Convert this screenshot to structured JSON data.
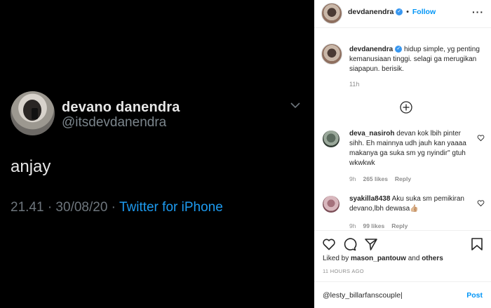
{
  "tweet": {
    "display_name": "devano danendra",
    "handle": "@itsdevdanendra",
    "text": "anjay",
    "datetime": "21.41 · 30/08/20 · ",
    "source": "Twitter for iPhone"
  },
  "instagram": {
    "header": {
      "username": "devdanendra",
      "follow_label": "Follow",
      "more_label": "···"
    },
    "caption": {
      "username": "devdanendra",
      "text": " hidup simple, yg penting kemanusiaan tinggi. selagi ga merugikan siapapun. berisik.",
      "time": "11h"
    },
    "comments": [
      {
        "username": "deva_nasiroh",
        "text": " devan kok lbih pinter sihh. Eh mainnya udh jauh kan yaaaa makanya ga suka sm yg nyindir\" gtuh wkwkwk",
        "time": "9h",
        "likes": "265 likes",
        "reply": "Reply"
      },
      {
        "username": "syakilla8438",
        "text": " Aku suka sm pemikiran devano,lbh dewasa👍🏼",
        "time": "9h",
        "likes": "99 likes",
        "reply": "Reply"
      }
    ],
    "liked_by_prefix": "Liked by ",
    "liked_by_user": "mason_pantouw",
    "liked_by_and": " and ",
    "liked_by_others": "others",
    "post_time": "11 HOURS AGO",
    "comment_input_value": "@lesty_billarfanscouple|",
    "post_label": "Post"
  },
  "colors": {
    "tweet_bg": "#000000",
    "link_blue": "#1d9bf0",
    "ig_blue": "#0095f6",
    "muted": "#8e8e8e"
  }
}
